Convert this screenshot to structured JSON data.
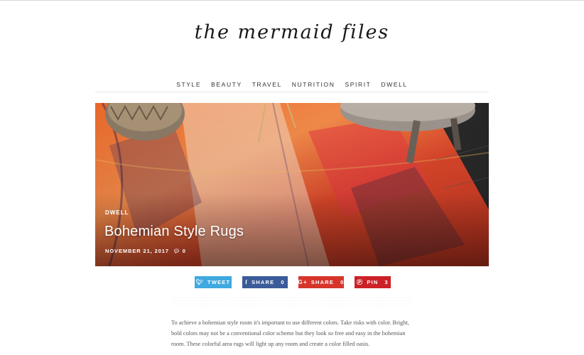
{
  "site": {
    "logo": "the mermaid files"
  },
  "nav": {
    "items": [
      "STYLE",
      "BEAUTY",
      "TRAVEL",
      "NUTRITION",
      "SPIRIT",
      "DWELL"
    ]
  },
  "post": {
    "category": "DWELL",
    "title": "Bohemian Style Rugs",
    "date": "NOVEMBER 21, 2017",
    "comments": "0",
    "comment_icon": "speech-bubble-icon"
  },
  "share": {
    "tweet_label": "TWEET",
    "tweet_icon": "twitter-icon",
    "facebook_label": "SHARE",
    "facebook_count": "0",
    "facebook_icon": "facebook-icon",
    "googleplus_label": "SHARE",
    "googleplus_count": "0",
    "googleplus_icon": "google-plus-icon",
    "pinterest_label": "PIN",
    "pinterest_count": "3",
    "pinterest_icon": "pinterest-icon"
  },
  "colors": {
    "twitter": "#3fa9e0",
    "facebook": "#3b5b99",
    "googleplus": "#d6352b",
    "pinterest": "#cc2127"
  },
  "article": {
    "lines": [
      "To achieve a bohemian style room it's important to use different colors. Take risks with color. Bright,",
      "bold colors may not be a conventional color scheme but they look so free and easy in the bohemian",
      "room. These colorful area rugs will light up any room and create a color filled oasis."
    ]
  }
}
